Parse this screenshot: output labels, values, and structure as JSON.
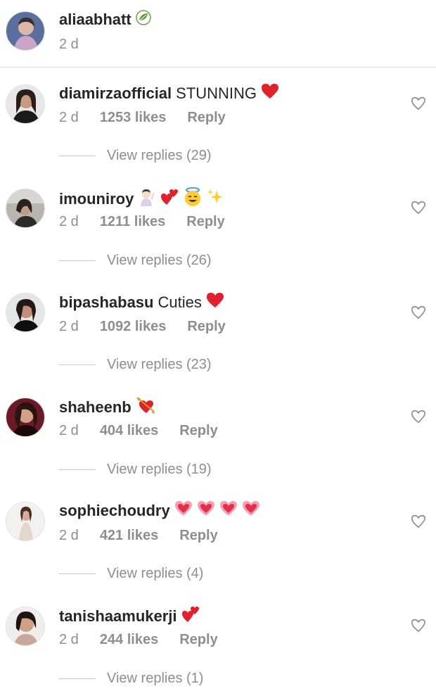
{
  "post": {
    "username": "aliaabhatt",
    "time": "2 d",
    "badge_icon": "leaf-icon"
  },
  "comments": [
    {
      "username": "diamirzaofficial",
      "text": "STUNNING",
      "emojis": [
        "red-heart-icon"
      ],
      "time": "2 d",
      "likes": "1253 likes",
      "reply": "Reply",
      "view_replies": "View replies (29)"
    },
    {
      "username": "imouniroy",
      "text": "",
      "emojis": [
        "raising-hand-icon",
        "two-hearts-icon",
        "smiling-halo-icon",
        "sparkles-icon"
      ],
      "time": "2 d",
      "likes": "1211 likes",
      "reply": "Reply",
      "view_replies": "View replies (26)"
    },
    {
      "username": "bipashabasu",
      "text": "Cuties",
      "emojis": [
        "red-heart-icon"
      ],
      "time": "2 d",
      "likes": "1092 likes",
      "reply": "Reply",
      "view_replies": "View replies (23)"
    },
    {
      "username": "shaheenb",
      "text": "",
      "emojis": [
        "heart-with-arrow-icon"
      ],
      "time": "2 d",
      "likes": "404 likes",
      "reply": "Reply",
      "view_replies": "View replies (19)"
    },
    {
      "username": "sophiechoudry",
      "text": "",
      "emojis": [
        "growing-heart-icon",
        "growing-heart-icon",
        "growing-heart-icon",
        "growing-heart-icon"
      ],
      "time": "2 d",
      "likes": "421 likes",
      "reply": "Reply",
      "view_replies": "View replies (4)"
    },
    {
      "username": "tanishaamukerji",
      "text": "",
      "emojis": [
        "two-hearts-icon"
      ],
      "time": "2 d",
      "likes": "244 likes",
      "reply": "Reply",
      "view_replies": "View replies (1)"
    }
  ],
  "colors": {
    "text": "#262626",
    "muted": "#8e8e8e",
    "heart_red": "#e0202a",
    "divider": "#dbdbdb"
  }
}
